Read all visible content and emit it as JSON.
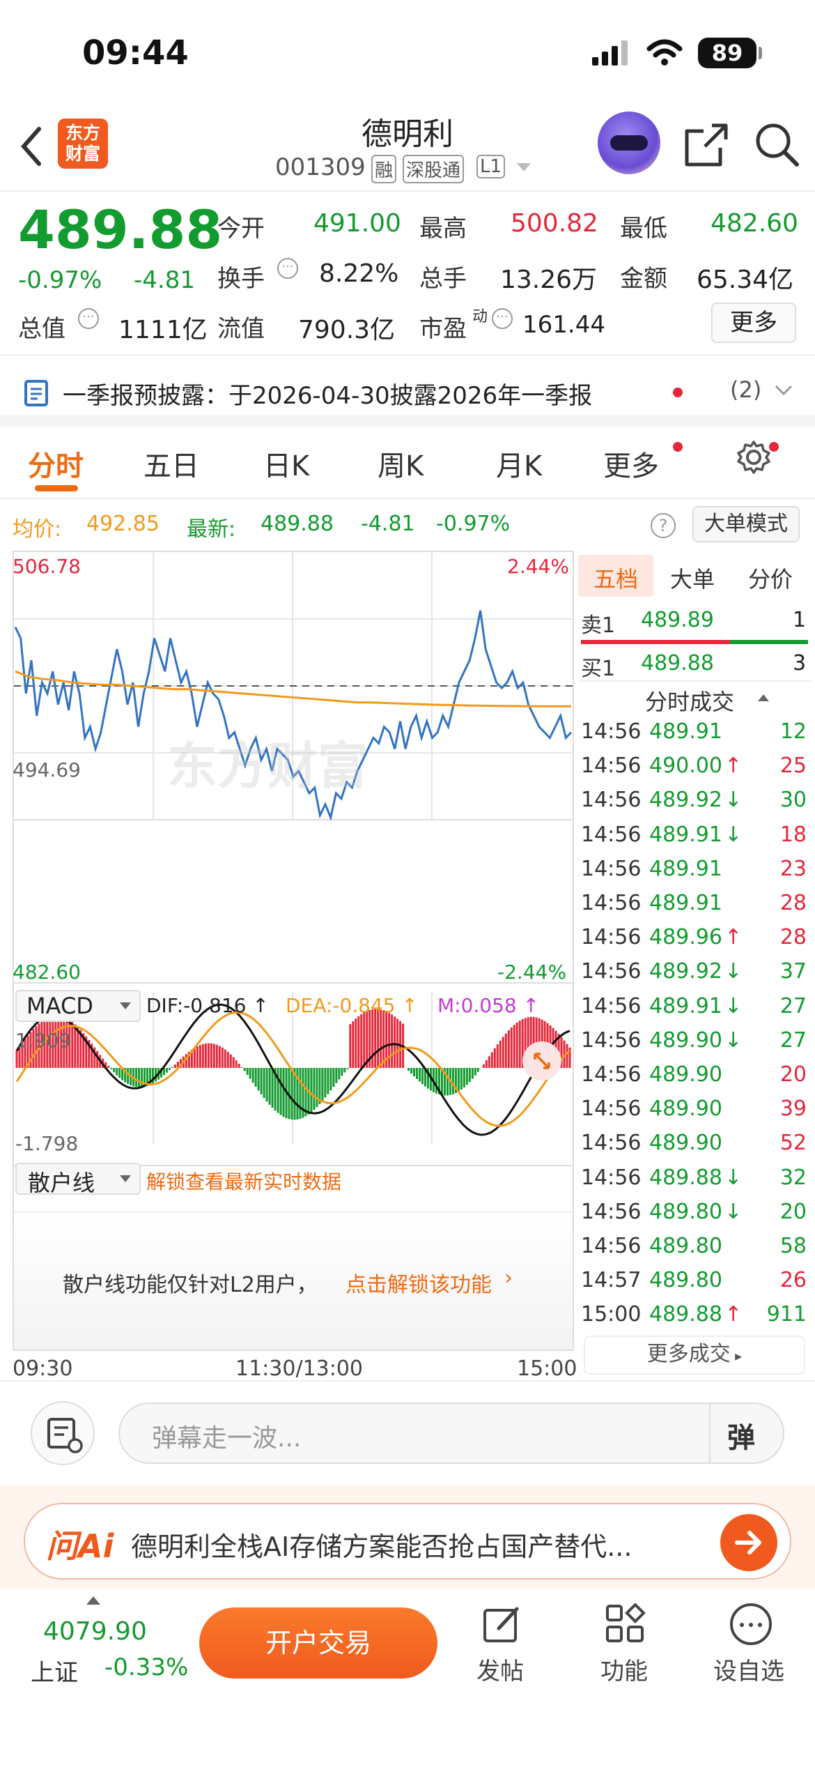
{
  "status": {
    "time": "09:44",
    "battery": "89"
  },
  "header": {
    "title": "德明利",
    "code": "001309",
    "tags": [
      "融",
      "深股通",
      "L1"
    ],
    "logo_text": [
      "东方",
      "财富"
    ]
  },
  "quote": {
    "price": "489.88",
    "change_pct": "-0.97%",
    "change": "-4.81",
    "open_label": "今开",
    "open": "491.00",
    "high_label": "最高",
    "high": "500.82",
    "low_label": "最低",
    "low": "482.60",
    "turnover_label": "换手",
    "turnover": "8.22%",
    "volume_label": "总手",
    "volume": "13.26万",
    "amount_label": "金额",
    "amount": "65.34亿",
    "mcap_label": "总值",
    "mcap": "1111亿",
    "float_label": "流值",
    "float": "790.3亿",
    "pe_label": "市盈",
    "pe_sup": "动",
    "pe": "161.44",
    "more": "更多"
  },
  "notice": {
    "text": "一季报预披露：于2026-04-30披露2026年一季报",
    "count": "(2)"
  },
  "tabs": [
    "分时",
    "五日",
    "日K",
    "周K",
    "月K",
    "更多"
  ],
  "infobar": {
    "avg_label": "均价:",
    "avg": "492.85",
    "latest_label": "最新:",
    "latest": "489.88",
    "chg": "-4.81",
    "chg_pct": "-0.97%",
    "mode": "大单模式"
  },
  "chart": {
    "ymax": "506.78",
    "ymin": "482.60",
    "mid": "494.69",
    "pct_max": "2.44%",
    "pct_min": "-2.44%",
    "macd_label": "MACD",
    "dif": "DIF:-0.816 ↑",
    "dea": "DEA:-0.845 ↑",
    "m": "M:0.058 ↑",
    "macd_max": "1.909",
    "macd_min": "-1.798",
    "retail_label": "散户线",
    "retail_unlock": "解锁查看最新实时数据",
    "retail_msg": "散户线功能仅针对L2用户，",
    "retail_link": "点击解锁该功能",
    "time_start": "09:30",
    "time_mid": "11:30/13:00",
    "time_end": "15:00",
    "watermark": "东方财富",
    "colors": {
      "price": "#3273c2",
      "avg": "#f29a1a",
      "macd_up": "#e5273a",
      "macd_down": "#129b2f"
    }
  },
  "chart_data": {
    "type": "line",
    "title": "",
    "xlabel": "",
    "ylabel": "",
    "ylim": [
      482.6,
      506.78
    ],
    "x_ticks": [
      "09:30",
      "11:30/13:00",
      "15:00"
    ],
    "series": [
      {
        "values": [
          500.0,
          499.0,
          494.0,
          497.0,
          492.0,
          495.0,
          494.0,
          496.0,
          493.0,
          495.0,
          492.5,
          496.0,
          494.0,
          490.0,
          491.0,
          489.0,
          490.5,
          493.0,
          495.5,
          498.0,
          496.0,
          493.0,
          495.0,
          491.0,
          494.0,
          496.0,
          499.0,
          497.5,
          496.0,
          499.0,
          497.0,
          495.0,
          496.0,
          494.0,
          491.0,
          493.0,
          495.0,
          494.0,
          493.5,
          492.0,
          490.0,
          490.5,
          489.0,
          487.5,
          489.0,
          490.0,
          488.0,
          489.0,
          487.0,
          489.0,
          488.5,
          488.0,
          486.5,
          487.0,
          486.0,
          485.0,
          485.5,
          483.0,
          484.0,
          482.8,
          485.0,
          484.5,
          486.0,
          485.5,
          487.0,
          488.0,
          489.0,
          490.0,
          489.5,
          491.0,
          490.5,
          489.0,
          491.5,
          489.0,
          491.0,
          492.0,
          490.0,
          491.5,
          490.0,
          490.5,
          492.0,
          491.0,
          493.0,
          495.0,
          496.0,
          497.0,
          499.0,
          501.5,
          498.0,
          496.5,
          495.0,
          494.5,
          495.0,
          496.0,
          494.5,
          495.0,
          493.0,
          492.0,
          491.0,
          490.5,
          490.0,
          491.0,
          492.0,
          490.0,
          490.5
        ]
      },
      {
        "values": [
          496.0,
          495.5,
          495.3,
          495.2,
          495.0,
          494.9,
          494.8,
          494.8,
          494.7,
          494.6,
          494.5,
          494.4,
          494.4,
          494.3,
          494.2,
          494.1,
          494.0,
          493.9,
          493.8,
          493.7,
          493.6,
          493.5,
          493.4,
          493.3,
          493.2,
          493.2,
          493.15,
          493.1,
          493.05,
          493.0,
          492.98,
          492.95,
          492.92,
          492.9,
          492.88,
          492.87,
          492.86,
          492.85,
          492.85,
          492.85
        ]
      }
    ]
  },
  "book": {
    "tabs": [
      "五档",
      "大单",
      "分价"
    ],
    "sell": {
      "label": "卖1",
      "price": "489.89",
      "vol": "1"
    },
    "buy": {
      "label": "买1",
      "price": "489.88",
      "vol": "3"
    },
    "trades_header": "分时成交",
    "more_trades": "更多成交",
    "trades": [
      {
        "t": "14:56",
        "p": "489.91",
        "a": "",
        "v": "12",
        "pc": "green",
        "vc": "green"
      },
      {
        "t": "14:56",
        "p": "490.00",
        "a": "↑",
        "v": "25",
        "pc": "green",
        "vc": "red"
      },
      {
        "t": "14:56",
        "p": "489.92",
        "a": "↓",
        "v": "30",
        "pc": "green",
        "vc": "green"
      },
      {
        "t": "14:56",
        "p": "489.91",
        "a": "↓",
        "v": "18",
        "pc": "green",
        "vc": "red"
      },
      {
        "t": "14:56",
        "p": "489.91",
        "a": "",
        "v": "23",
        "pc": "green",
        "vc": "red"
      },
      {
        "t": "14:56",
        "p": "489.91",
        "a": "",
        "v": "28",
        "pc": "green",
        "vc": "red"
      },
      {
        "t": "14:56",
        "p": "489.96",
        "a": "↑",
        "v": "28",
        "pc": "green",
        "vc": "red"
      },
      {
        "t": "14:56",
        "p": "489.92",
        "a": "↓",
        "v": "37",
        "pc": "green",
        "vc": "green"
      },
      {
        "t": "14:56",
        "p": "489.91",
        "a": "↓",
        "v": "27",
        "pc": "green",
        "vc": "green"
      },
      {
        "t": "14:56",
        "p": "489.90",
        "a": "↓",
        "v": "27",
        "pc": "green",
        "vc": "green"
      },
      {
        "t": "14:56",
        "p": "489.90",
        "a": "",
        "v": "20",
        "pc": "green",
        "vc": "red"
      },
      {
        "t": "14:56",
        "p": "489.90",
        "a": "",
        "v": "39",
        "pc": "green",
        "vc": "red"
      },
      {
        "t": "14:56",
        "p": "489.90",
        "a": "",
        "v": "52",
        "pc": "green",
        "vc": "red"
      },
      {
        "t": "14:56",
        "p": "489.88",
        "a": "↓",
        "v": "32",
        "pc": "green",
        "vc": "green"
      },
      {
        "t": "14:56",
        "p": "489.80",
        "a": "↓",
        "v": "20",
        "pc": "green",
        "vc": "green"
      },
      {
        "t": "14:56",
        "p": "489.80",
        "a": "",
        "v": "58",
        "pc": "green",
        "vc": "green"
      },
      {
        "t": "14:57",
        "p": "489.80",
        "a": "",
        "v": "26",
        "pc": "green",
        "vc": "red"
      },
      {
        "t": "15:00",
        "p": "489.88",
        "a": "↑",
        "v": "911",
        "pc": "green",
        "vc": "green"
      }
    ]
  },
  "comment": {
    "placeholder": "弹幕走一波..."
  },
  "ai": {
    "label": "问Ai",
    "text": "德明利全栈AI存储方案能否抢占国产替代..."
  },
  "nav": {
    "index_value": "4079.90",
    "index_name": "上证",
    "index_pct": "-0.33%",
    "trade_btn": "开户交易",
    "post": "发帖",
    "func": "功能",
    "watch": "设自选"
  }
}
